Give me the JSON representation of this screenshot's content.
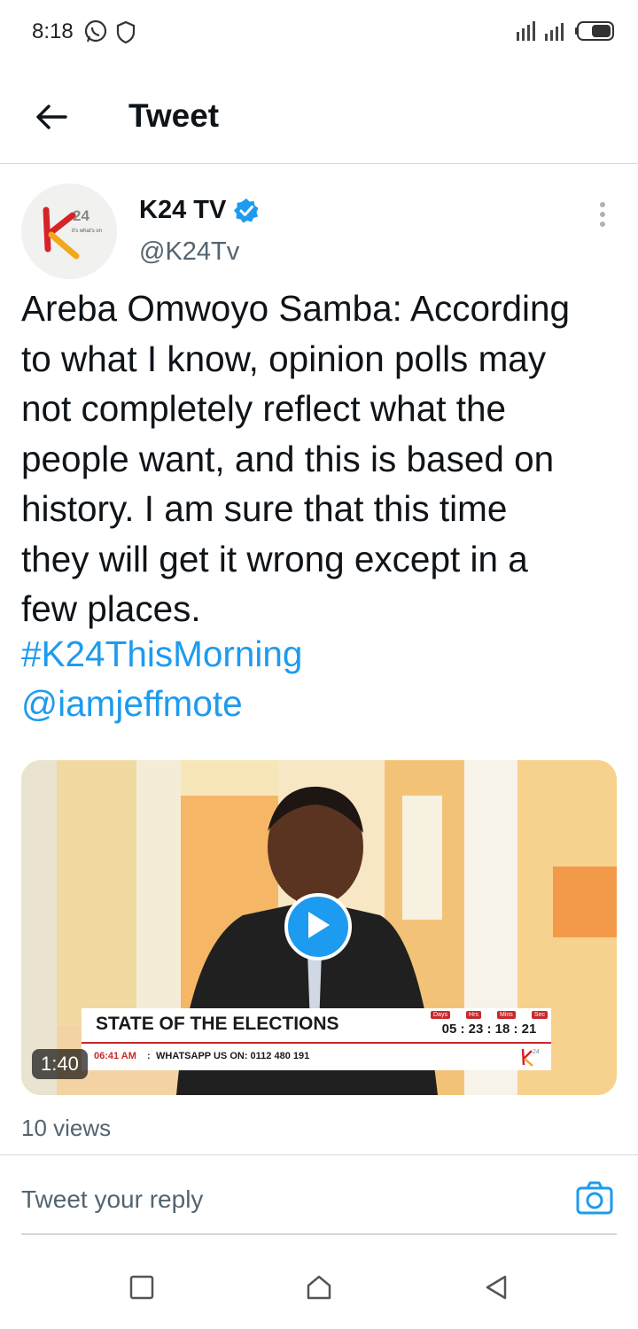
{
  "status_bar": {
    "time": "8:18"
  },
  "header": {
    "title": "Tweet"
  },
  "author": {
    "name": "K24 TV",
    "handle": "@K24Tv",
    "logo_text": "24",
    "logo_tagline": "it's what's on"
  },
  "tweet": {
    "text": "Areba Omwoyo Samba: According\nto what I know, opinion polls may\nnot completely reflect what the\npeople want, and this is based on\nhistory. I am sure that this time\nthey will get it wrong except in a\nfew places.",
    "hashtag": "#K24ThisMorning",
    "mention": "@iamjeffmote"
  },
  "media": {
    "duration": "1:40",
    "headline": "STATE OF THE ELECTIONS",
    "countdown_labels": [
      "Days",
      "Hrs",
      "Mins",
      "Sec"
    ],
    "countdown": "05 : 23 : 18 : 21",
    "clock_time": "06:41 AM",
    "separator": ":",
    "ticker": "WHATSAPP US ON: 0112 480 191"
  },
  "views": "10 views",
  "reply": {
    "placeholder": "Tweet your reply"
  },
  "colors": {
    "accent": "#1d9bf0",
    "text": "#0f1419",
    "secondary": "#536471",
    "divider": "#d6d9db"
  }
}
